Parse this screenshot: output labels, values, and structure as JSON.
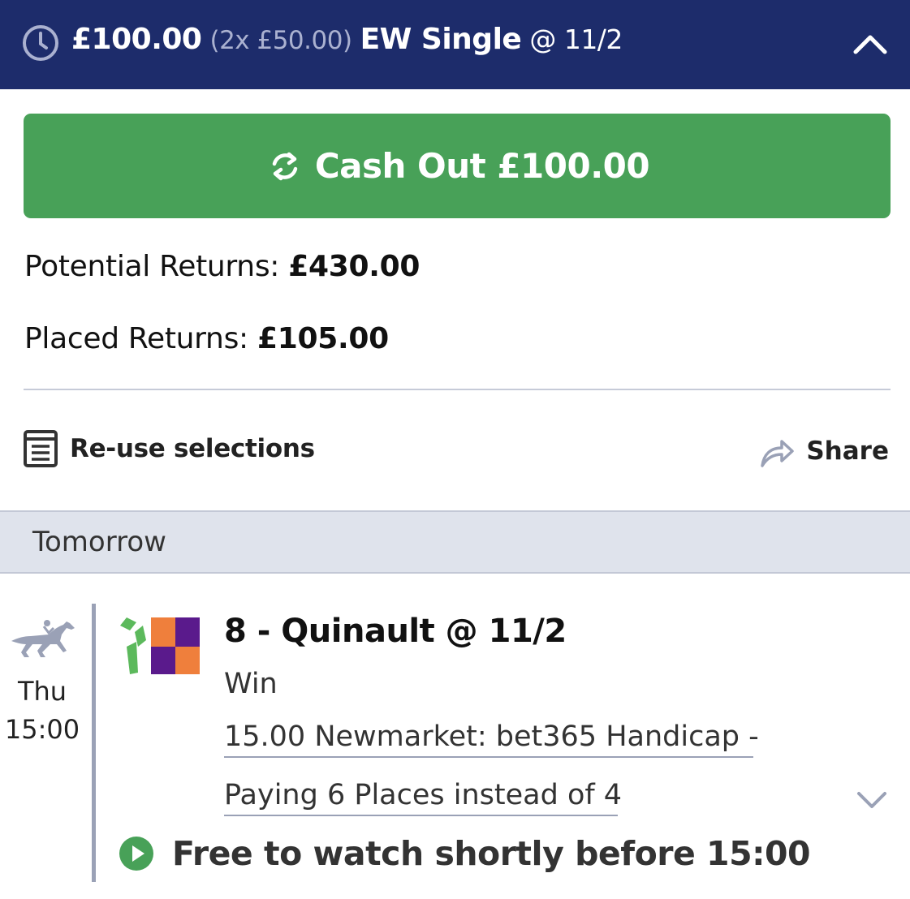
{
  "header": {
    "stake": "£100.00",
    "split": "(2x £50.00)",
    "bet_type": "EW Single",
    "odds": "@ 11/2",
    "clock_icon": "clock-icon",
    "collapse_icon": "chevron-up-icon"
  },
  "cashout": {
    "label": "Cash Out £100.00",
    "icon": "refresh-arrows-icon",
    "color": "#48a158"
  },
  "returns": {
    "potential_label": "Potential Returns:",
    "potential_value": "£430.00",
    "placed_label": "Placed Returns:",
    "placed_value": "£105.00"
  },
  "actions": {
    "reuse_label": "Re-use selections",
    "share_label": "Share"
  },
  "day_band": {
    "label": "Tomorrow"
  },
  "selection": {
    "day": "Thu",
    "time": "15:00",
    "runner": "8 - Quinault @ 11/2",
    "market": "Win",
    "event_line1": "15.00 Newmarket: bet365 Handicap -",
    "event_line2": "Paying 6 Places instead of 4",
    "sport_icon": "horse-racing-icon"
  },
  "stream": {
    "label": "Free to watch shortly before 15:00",
    "icon": "play-icon"
  },
  "colors": {
    "header_bg": "#1d2c6b",
    "accent_green": "#48a158"
  }
}
